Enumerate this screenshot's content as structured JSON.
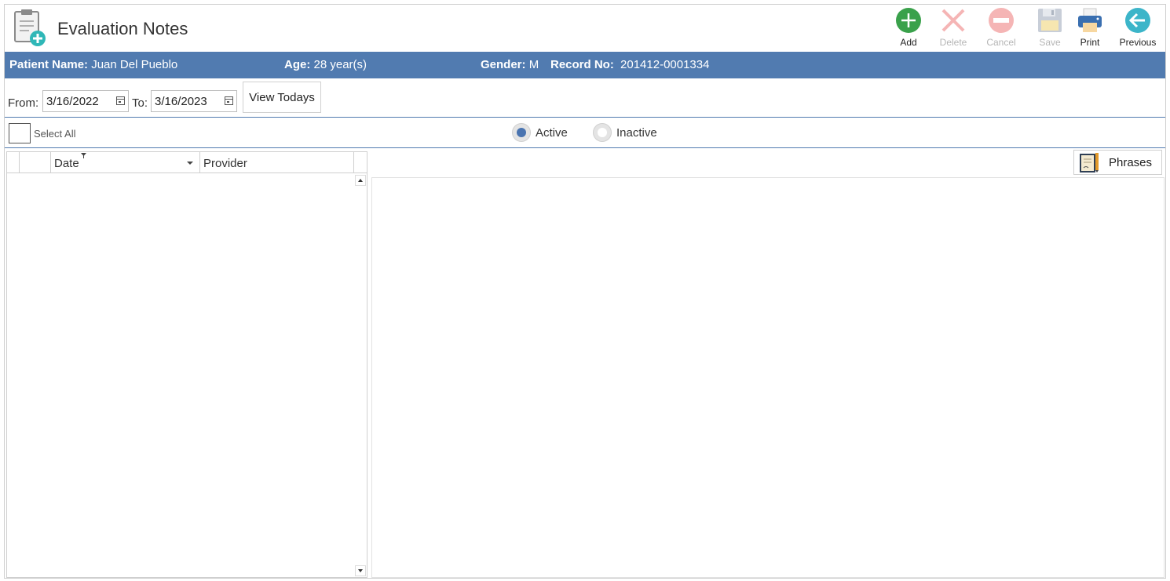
{
  "header": {
    "title": "Evaluation Notes",
    "app_icon": "clipboard-add-icon"
  },
  "toolbar": {
    "add": {
      "label": "Add",
      "icon": "plus-circle-icon",
      "color": "#3aa14b",
      "enabled": true
    },
    "delete": {
      "label": "Delete",
      "icon": "x-icon",
      "color": "#f5b5b5",
      "enabled": false
    },
    "cancel": {
      "label": "Cancel",
      "icon": "minus-circle-icon",
      "color": "#f5b5b5",
      "enabled": false
    },
    "save": {
      "label": "Save",
      "icon": "floppy-disk-icon",
      "color": "#c8ced8",
      "enabled": false
    },
    "print": {
      "label": "Print",
      "icon": "printer-icon",
      "color": "#3a6fb0",
      "enabled": true
    },
    "previous": {
      "label": "Previous",
      "icon": "arrow-left-circle-icon",
      "color": "#3cb5c9",
      "enabled": true
    }
  },
  "patient": {
    "name_label": "Patient Name:",
    "name": "Juan Del Pueblo",
    "age_label": "Age:",
    "age": "28 year(s)",
    "gender_label": "Gender:",
    "gender": "M",
    "record_label": "Record No:",
    "record": "201412-0001334",
    "bar_color": "#517bb0"
  },
  "filter": {
    "from_label": "From:",
    "from_value": "3/16/2022",
    "to_label": "To:",
    "to_value": "3/16/2023",
    "view_todays_label": "View Todays"
  },
  "selection": {
    "select_all_label": "Select All",
    "select_all_checked": false,
    "status_options": [
      {
        "label": "Active",
        "selected": true
      },
      {
        "label": "Inactive",
        "selected": false
      }
    ]
  },
  "grid": {
    "columns": [
      "",
      "",
      "Date",
      "Provider"
    ],
    "rows": []
  },
  "phrases": {
    "label": "Phrases",
    "icon": "document-pencil-icon"
  }
}
